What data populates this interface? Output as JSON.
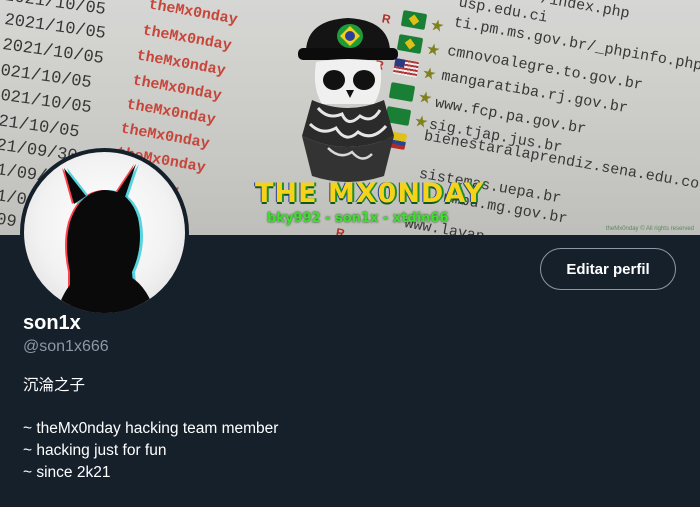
{
  "banner": {
    "dates": [
      "2021/10/05",
      "2021/10/05",
      "2021/10/05",
      "021/10/05",
      "021/10/05",
      "21/10/05",
      "21/09/30",
      "1/09/30",
      "1/09",
      "09"
    ],
    "team_tags": [
      "theMx0nday",
      "theMx0nday",
      "theMx0nday",
      "theMx0nday",
      "theMx0nday",
      "theMx0nday",
      "theMx0nday",
      "Mx0nday"
    ],
    "sites": [
      "usp.edu.ci",
      "ti.pm.ms.gov.br/_phpinfo.php",
      "cmnovoalegre.to.gov.br",
      "mangaratiba.rj.gov.br",
      "www.fcp.pa.gov.br",
      "sig.tjap.jus.br",
      "bienestaralaprendiz.sena.edu.co",
      "sistemas.uepa.br",
      "umbu.mg.gov.br",
      "www.lavan"
    ],
    "top_path": "/index.php",
    "logo_title": "THE MX0NDAY",
    "logo_subtitle": "bky992 - son1x - xtdin66",
    "watermark": "theMx0nday © All rights reserved",
    "colors": {
      "logo_yellow": "#f7d21a",
      "logo_green": "#3fe02f",
      "defacer_red": "#d84b3e"
    }
  },
  "profile": {
    "edit_button_label": "Editar perfil",
    "display_name": "son1x",
    "handle": "@son1x666",
    "bio": {
      "name_line": "沉淪之子",
      "lines": [
        "~ theMx0nday hacking team member",
        "~ hacking just for fun",
        "~ since 2k21"
      ]
    }
  },
  "theme": {
    "background": "#15202b",
    "secondary_text": "#8b98a5"
  }
}
